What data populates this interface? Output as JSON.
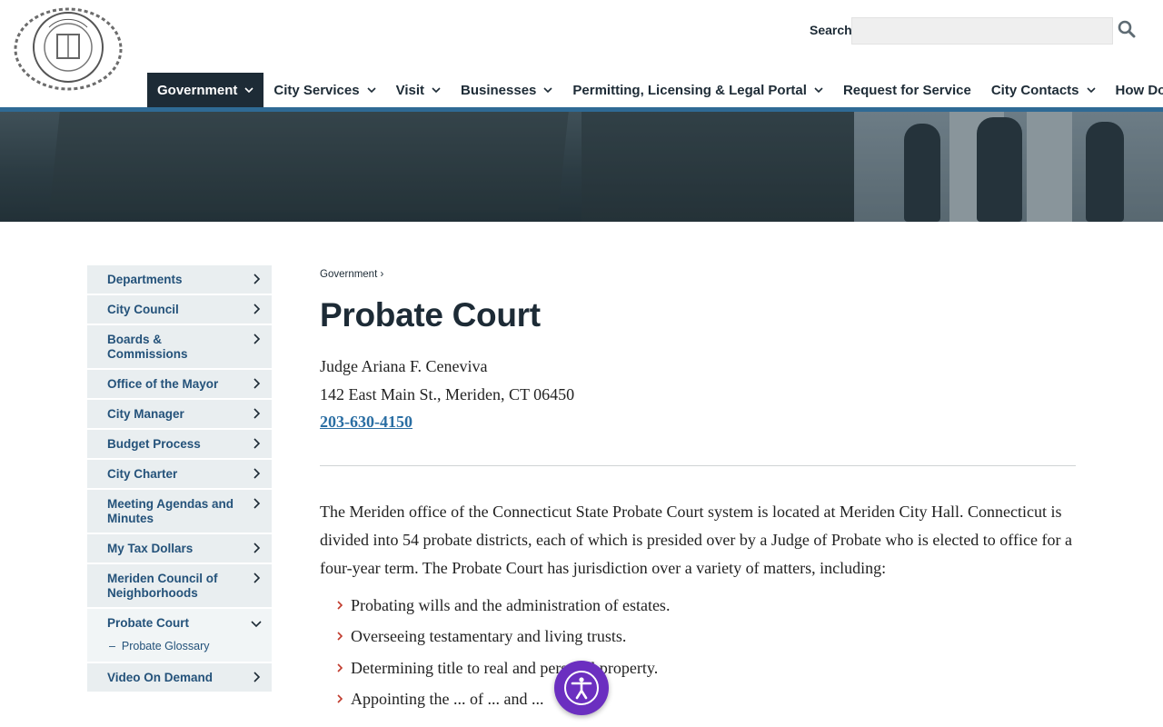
{
  "header": {
    "logo_alt": "CITY OF MERIDEN MDCCCLXVII",
    "search_label": "Search",
    "search_placeholder": "",
    "search_icon": "magnifier-icon"
  },
  "nav": {
    "items": [
      {
        "label": "Government",
        "active": true,
        "has_menu": true
      },
      {
        "label": "City Services",
        "active": false,
        "has_menu": true
      },
      {
        "label": "Visit",
        "active": false,
        "has_menu": true
      },
      {
        "label": "Businesses",
        "active": false,
        "has_menu": true
      },
      {
        "label": "Permitting, Licensing & Legal Portal",
        "active": false,
        "has_menu": true
      },
      {
        "label": "Request for Service",
        "active": false,
        "has_menu": false
      },
      {
        "label": "City Contacts",
        "active": false,
        "has_menu": true
      },
      {
        "label": "How Do I?",
        "active": false,
        "has_menu": true
      }
    ]
  },
  "sidebar": {
    "items": [
      {
        "label": "Departments"
      },
      {
        "label": "City Council"
      },
      {
        "label": "Boards & Commissions"
      },
      {
        "label": "Office of the Mayor"
      },
      {
        "label": "City Manager"
      },
      {
        "label": "Budget Process"
      },
      {
        "label": "City Charter"
      },
      {
        "label": "Meeting Agendas and Minutes"
      },
      {
        "label": "My Tax Dollars"
      },
      {
        "label": "Meriden Council of Neighborhoods"
      },
      {
        "label": "Probate Court",
        "open": true,
        "sub": "Probate Glossary"
      },
      {
        "label": "Video On Demand"
      }
    ]
  },
  "breadcrumb": {
    "items": [
      "Government"
    ],
    "separator": "›"
  },
  "page": {
    "title": "Probate Court",
    "judge": "Judge Ariana F. Ceneviva",
    "address": "142 East Main St., Meriden, CT 06450",
    "phone": "203-630-4150",
    "intro": "The Meriden office of the Connecticut State Probate Court system is located at Meriden City Hall. Connecticut is divided into 54 probate districts, each of which is presided over by a Judge of Probate who is elected to office for a four-year term.  The Probate Court has jurisdiction over a variety of matters, including:",
    "list": [
      "Probating wills and the administration of estates.",
      "Overseeing testamentary and living trusts.",
      "Determining title to real and personal property.",
      "Appointing the ... of ... and ..."
    ]
  },
  "a11y_widget": {
    "icon": "accessibility-icon"
  },
  "colors": {
    "nav_active": "#1d2b36",
    "accent_line": "#2f6a95",
    "link": "#24527a",
    "widget": "#6b2fc0"
  }
}
